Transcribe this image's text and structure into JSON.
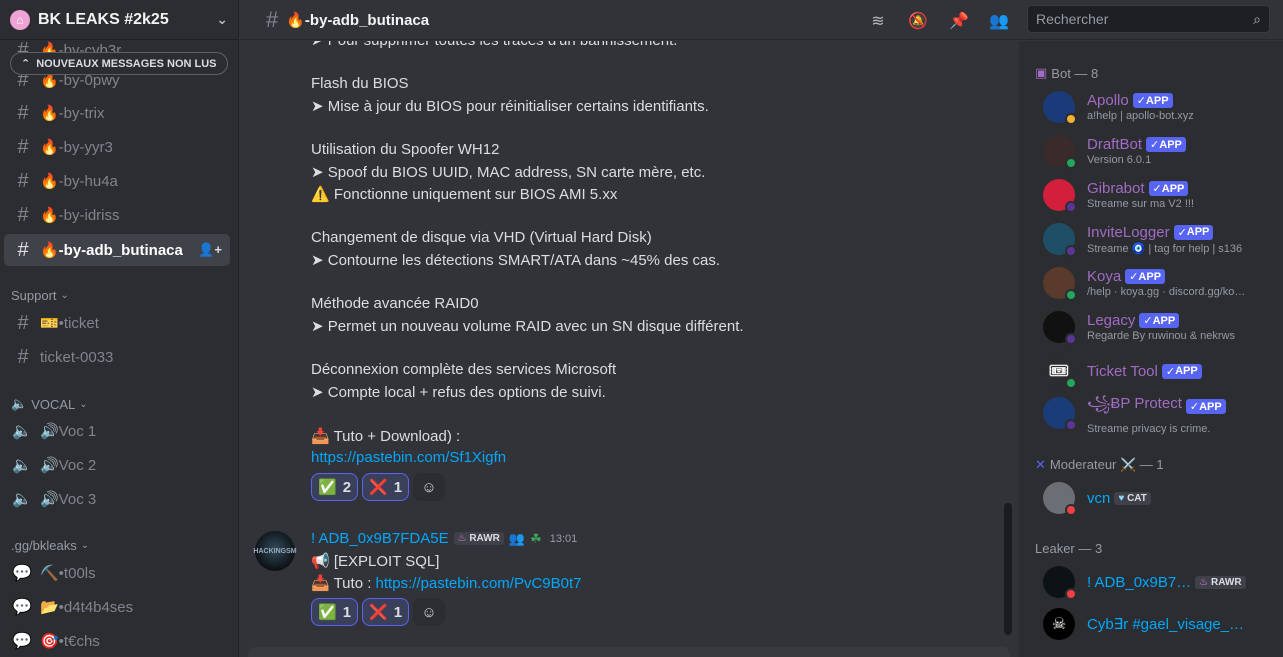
{
  "server": {
    "name": "BK LEAKS #2k25"
  },
  "unread_pill": "NOUVEAUX MESSAGES NON LUS",
  "channels": [
    {
      "label": "🔥-by-cyb3r"
    },
    {
      "label": "🔥-by-0pwy"
    },
    {
      "label": "🔥-by-trix"
    },
    {
      "label": "🔥-by-yyr3"
    },
    {
      "label": "🔥-by-hu4a"
    },
    {
      "label": "🔥-by-idriss"
    },
    {
      "label": "🔥-by-adb_butinaca"
    }
  ],
  "support": {
    "title": "Support",
    "items": [
      {
        "label": "🎫•ticket"
      },
      {
        "label": "ticket-0033"
      }
    ]
  },
  "vocal": {
    "title": "VOCAL",
    "items": [
      {
        "label": "🔊Voc 1"
      },
      {
        "label": "🔊Voc 2"
      },
      {
        "label": "🔊Voc 3"
      }
    ]
  },
  "gg": {
    "title": ".gg/bkleaks",
    "items": [
      {
        "label": "⛏️•t00ls"
      },
      {
        "label": "📂•d4t4b4ses"
      },
      {
        "label": "🎯•t€chs"
      }
    ]
  },
  "topbar": {
    "channel": "🔥-by-adb_butinaca",
    "search_placeholder": "Rechercher"
  },
  "message1": {
    "lines": [
      "➤ Pour supprimer toutes les traces d'un bannissement.",
      "Flash du BIOS",
      "➤ Mise à jour du BIOS pour réinitialiser certains identifiants.",
      "Utilisation du Spoofer WH12",
      "➤ Spoof du BIOS UUID, MAC address, SN carte mère, etc.",
      "⚠️ Fonctionne uniquement sur BIOS AMI 5.xx",
      "Changement de disque via VHD (Virtual Hard Disk)",
      "➤ Contourne les détections SMART/ATA dans ~45% des cas.",
      "Méthode avancée RAID0",
      "➤ Permet un nouveau volume RAID avec un SN disque différent.",
      "Déconnexion complète des services Microsoft",
      "➤ Compte local + refus des options de suivi.",
      "📥 Tuto + Download) :"
    ],
    "link": "https://pastebin.com/Sf1Xigfn",
    "reactions": [
      {
        "emoji": "✅",
        "count": "2"
      },
      {
        "emoji": "❌",
        "count": "1"
      }
    ]
  },
  "message2": {
    "author": "! ADB_0x9B7FDA5E",
    "badge": "RAWR",
    "time": "13:01",
    "avatar_text": "HACKINGSM",
    "line1": "📢 [EXPLOIT SQL]",
    "line2_prefix": "📥 Tuto : ",
    "link": "https://pastebin.com/PvC9B0t7",
    "reactions": [
      {
        "emoji": "✅",
        "count": "1"
      },
      {
        "emoji": "❌",
        "count": "1"
      }
    ]
  },
  "members": {
    "bot_group": "Bot — 8",
    "bots": [
      {
        "name": "Apollo",
        "sub": "a!help | apollo-bot.xyz",
        "color": "#1a3a7a"
      },
      {
        "name": "DraftBot",
        "sub": "Version 6.0.1",
        "color": "#3b2a2a"
      },
      {
        "name": "Gibrabot",
        "sub": "Streame sur ma V2 !!!",
        "color": "#d21f3c"
      },
      {
        "name": "InviteLogger",
        "sub": "Streame 🧿 | tag for help | s136",
        "color": "#1f4f66"
      },
      {
        "name": "Koya",
        "sub": "/help · koya.gg · discord.gg/ko…",
        "color": "#5a3a2a"
      },
      {
        "name": "Legacy",
        "sub": "Regarde By ruwinou & nekrws",
        "color": "#111111"
      },
      {
        "name": "Ticket Tool",
        "sub": "",
        "color": "#2b2d31"
      },
      {
        "name": "꧁ɃP Protect",
        "sub": "Streame privacy is crime.",
        "color": "#1a3d7a"
      }
    ],
    "app_label": "APP",
    "moderator_group": "Moderateur ⚔️ — 1",
    "moderator": {
      "name": "vcn",
      "badge": "CAT"
    },
    "leaker_group": "Leaker — 3",
    "leakers": [
      {
        "name": "! ADB_0x9B7…",
        "badge": "RAWR"
      },
      {
        "name": "Cyb∃r #gael_visage_…"
      }
    ]
  },
  "colors": {
    "accent": "#5865f2",
    "link": "#00a8fc",
    "bot_name": "#a16bc4"
  }
}
